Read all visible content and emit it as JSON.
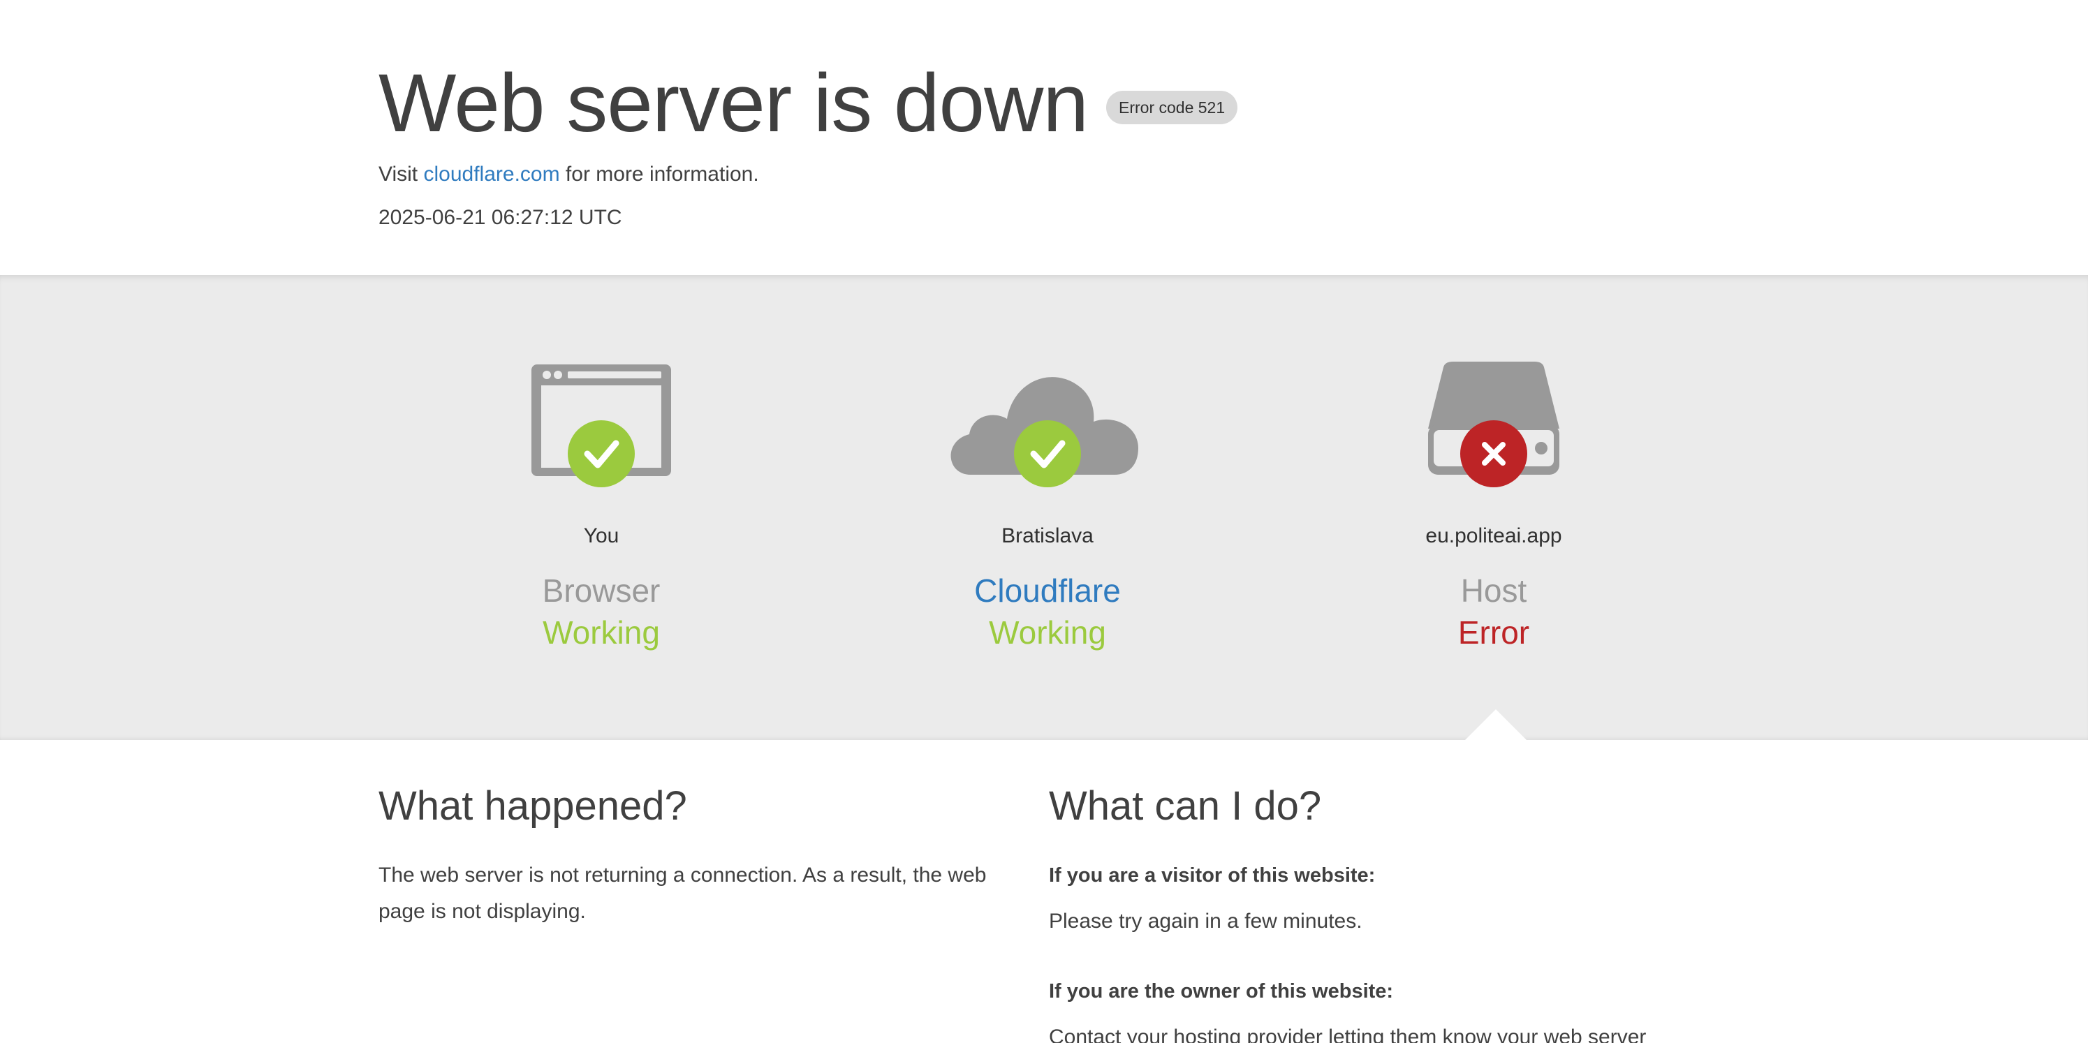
{
  "header": {
    "title": "Web server is down",
    "error_badge": "Error code 521",
    "visit_prefix": "Visit",
    "visit_link": "cloudflare.com",
    "visit_suffix": "for more information.",
    "timestamp": "2025-06-21 06:27:12 UTC"
  },
  "status": [
    {
      "location": "You",
      "kind": "Browser",
      "state": "Working",
      "icon": "browser-icon",
      "badge_icon": "check-icon",
      "state_color": "#9bca3e"
    },
    {
      "location": "Bratislava",
      "kind": "Cloudflare",
      "state": "Working",
      "icon": "cloud-icon",
      "badge_icon": "check-icon",
      "state_color": "#9bca3e"
    },
    {
      "location": "eu.politeai.app",
      "kind": "Host",
      "state": "Error",
      "icon": "server-icon",
      "badge_icon": "x-icon",
      "state_color": "#bd2426"
    }
  ],
  "what_happened": {
    "heading": "What happened?",
    "text": "The web server is not returning a connection. As a result, the web page is not displaying."
  },
  "what_can_i_do": {
    "heading": "What can I do?",
    "visitor_heading": "If you are a visitor of this website:",
    "visitor_text": "Please try again in a few minutes.",
    "owner_heading": "If you are the owner of this website:",
    "owner_text": "Contact your hosting provider letting them know your web server"
  },
  "colors": {
    "link": "#2f7bbf",
    "ok": "#9bca3e",
    "error": "#bd2426",
    "icon_gray": "#999999",
    "band": "#ebebeb"
  }
}
